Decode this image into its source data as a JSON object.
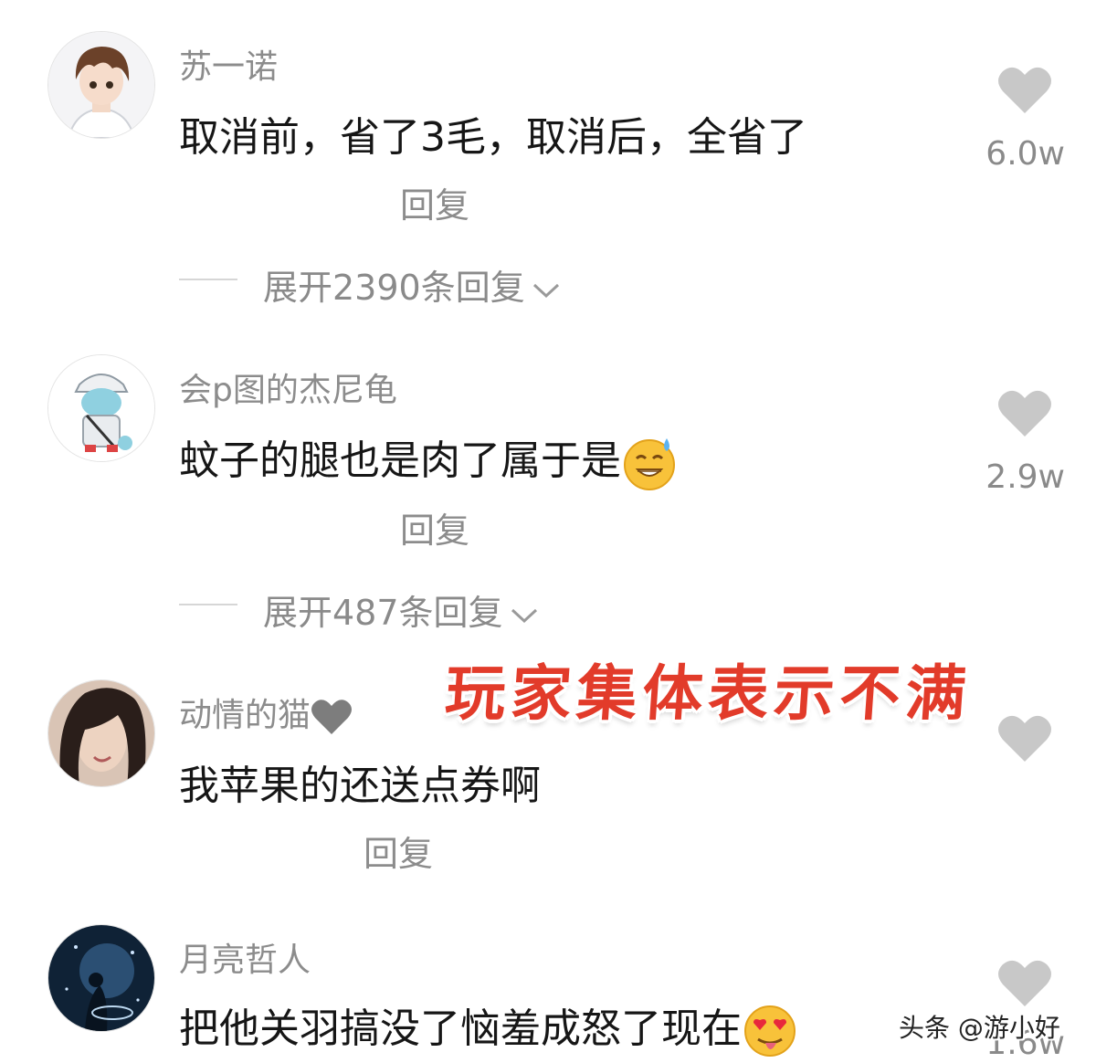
{
  "comments": [
    {
      "username": "苏一诺",
      "content": "取消前，省了3毛，取消后，全省了",
      "reply_label": "回复",
      "like_count": "6.0w",
      "expand_label": "展开2390条回复"
    },
    {
      "username": "会p图的杰尼龟",
      "content": "蚊子的腿也是肉了属于是",
      "emoji": "grinning-sweat-emoji",
      "reply_label": "回复",
      "like_count": "2.9w",
      "expand_label": "展开487条回复"
    },
    {
      "username": "动情的猫",
      "name_emoji": "grey-heart-emoji",
      "content": "我苹果的还送点券啊",
      "reply_label": "回复"
    },
    {
      "username": "月亮哲人",
      "content": "把他关羽搞没了恼羞成怒了现在",
      "emoji": "heart-eyes-tongue-emoji",
      "like_count": "1.6w"
    }
  ],
  "overlay_title": "玩家集体表示不满",
  "watermark": "头条 @游小好",
  "colors": {
    "overlay_red": "#e23b2a",
    "muted_text": "#8c8c8c",
    "main_text": "#161616",
    "like_icon": "#c8c8c8"
  }
}
